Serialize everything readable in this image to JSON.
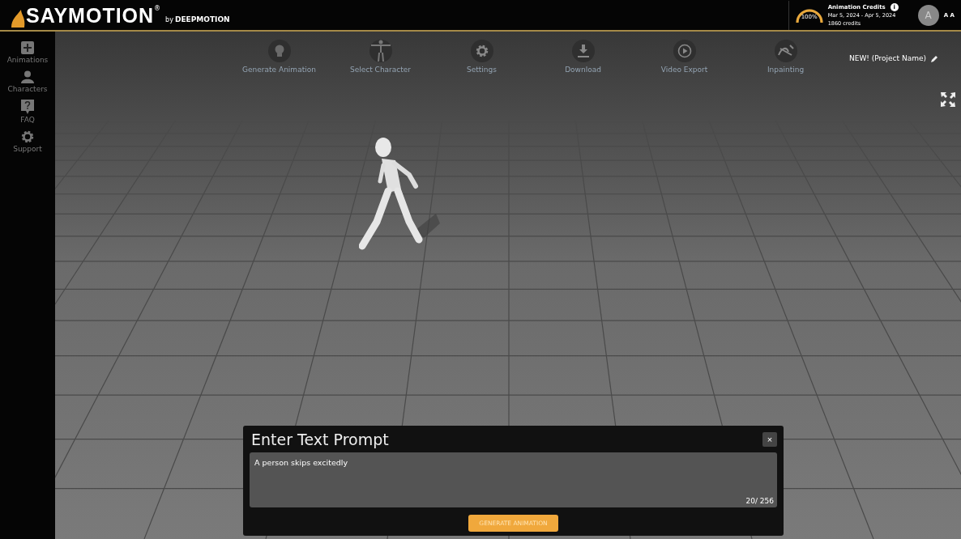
{
  "header": {
    "logo": "SAYMOTION",
    "logo_mark": "®",
    "byline": "by",
    "brand": "DEEPMOTION",
    "credits": {
      "gauge": {
        "level": 1,
        "reading": "100%"
      },
      "title": "Animation Credits",
      "info": "i",
      "period": "Mar 5, 2024 - Apr 5, 2024",
      "amount": "1860 credits"
    },
    "avatar": "A",
    "user": "A A"
  },
  "sidebar": {
    "items": [
      {
        "label": "Animations"
      },
      {
        "label": "Characters"
      },
      {
        "label": "FAQ"
      },
      {
        "label": "Support"
      }
    ]
  },
  "toolbar": {
    "items": [
      {
        "label": "Generate Animation"
      },
      {
        "label": "Select Character"
      },
      {
        "label": "Settings"
      },
      {
        "label": "Download"
      },
      {
        "label": "Video Export"
      },
      {
        "label": "Inpainting"
      }
    ]
  },
  "project": {
    "name": "NEW! (Project Name)"
  },
  "prompt_dialog": {
    "title": "Enter Text Prompt",
    "close": "×",
    "value": "A person skips excitedly",
    "counter": "20/ 256",
    "button": "GENERATE ANIMATION"
  }
}
